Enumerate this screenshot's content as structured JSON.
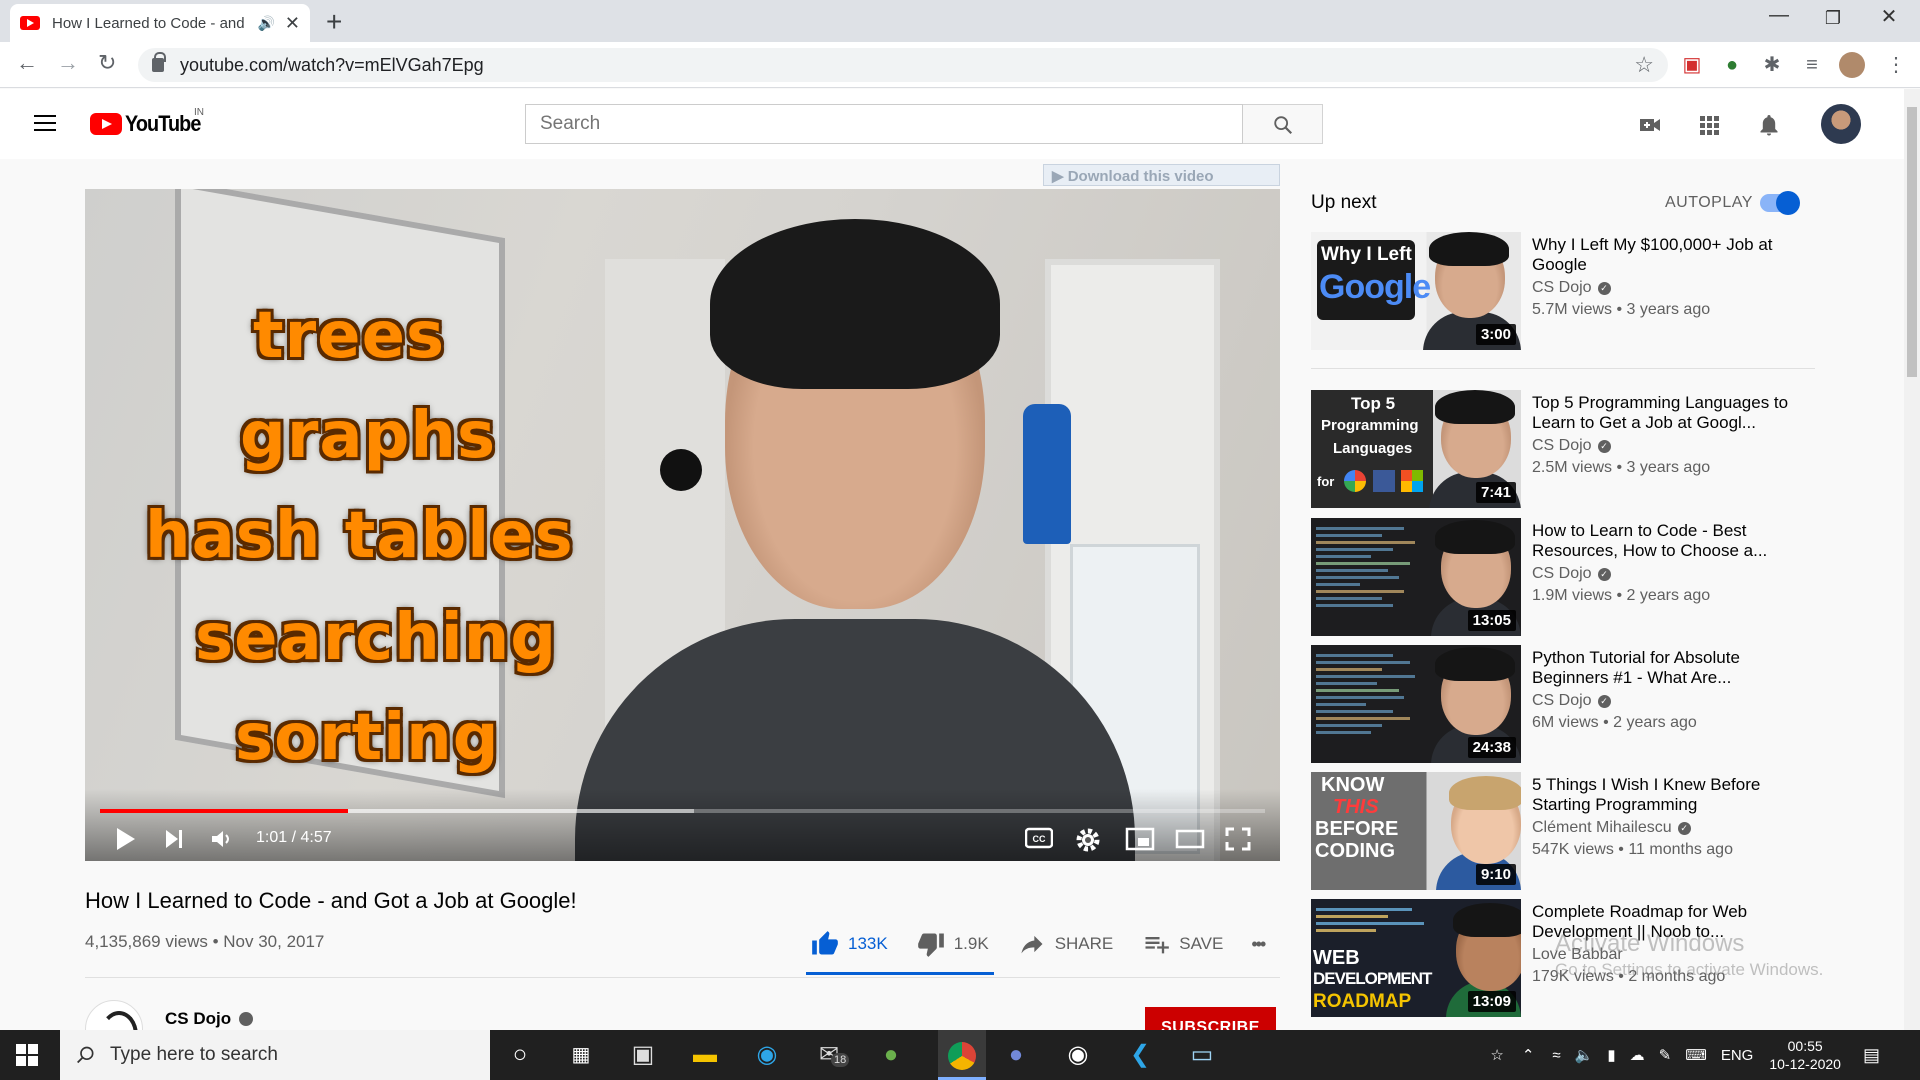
{
  "browser": {
    "tab_title": "How I Learned to Code - and",
    "url": "youtube.com/watch?v=mElVGah7Epg"
  },
  "youtube": {
    "logo_text": "YouTube",
    "country_code": "IN",
    "search_placeholder": "Search",
    "download_bar": "▶ Download this video",
    "player": {
      "overlay_words": [
        "trees",
        "graphs",
        "hash tables",
        "searching",
        "sorting"
      ],
      "current_time": "1:01 / 4:57",
      "progress_fraction": 0.213,
      "buffered_fraction": 0.51
    },
    "video": {
      "title": "How I Learned to Code - and Got a Job at Google!",
      "meta": "4,135,869 views • Nov 30, 2017",
      "likes": "133K",
      "dislikes": "1.9K",
      "share_label": "SHARE",
      "save_label": "SAVE",
      "more_label": "•••"
    },
    "channel": {
      "name": "CS Dojo",
      "subscribe_label": "SUBSCRIBE"
    },
    "sidebar": {
      "up_next": "Up next",
      "autoplay": "AUTOPLAY",
      "autoplay_on": true,
      "items": [
        {
          "title": "Why I Left My $100,000+ Job at Google",
          "channel": "CS Dojo",
          "views": "5.7M views • 3 years ago",
          "duration": "3:00",
          "thumb_text": [
            "Why I Left",
            "Google"
          ]
        },
        {
          "title": "Top 5 Programming Languages to Learn to Get a Job at Googl...",
          "channel": "CS Dojo",
          "views": "2.5M views • 3 years ago",
          "duration": "7:41",
          "thumb_text": [
            "Top 5",
            "Programming",
            "Languages",
            "for"
          ]
        },
        {
          "title": "How to Learn to Code - Best Resources, How to Choose a...",
          "channel": "CS Dojo",
          "views": "1.9M views • 2 years ago",
          "duration": "13:05"
        },
        {
          "title": "Python Tutorial for Absolute Beginners #1 - What Are...",
          "channel": "CS Dojo",
          "views": "6M views • 2 years ago",
          "duration": "24:38"
        },
        {
          "title": "5 Things I Wish I Knew Before Starting Programming",
          "channel": "Clément Mihailescu",
          "views": "547K views • 11 months ago",
          "duration": "9:10",
          "thumb_text": [
            "KNOW",
            "THIS",
            "BEFORE",
            "CODING"
          ]
        },
        {
          "title": "Complete Roadmap for Web Development || Noob to...",
          "channel": "Love Babbar",
          "views": "179K views • 2 months ago",
          "duration": "13:09",
          "thumb_text": [
            "WEB",
            "DEVELOPMENT",
            "ROADMAP"
          ]
        }
      ]
    }
  },
  "watermark": {
    "line1": "Activate Windows",
    "line2": "Go to Settings to activate Windows."
  },
  "taskbar": {
    "search_placeholder": "Type here to search",
    "mail_badge": "18",
    "language": "ENG",
    "time": "00:55",
    "date": "10-12-2020"
  }
}
